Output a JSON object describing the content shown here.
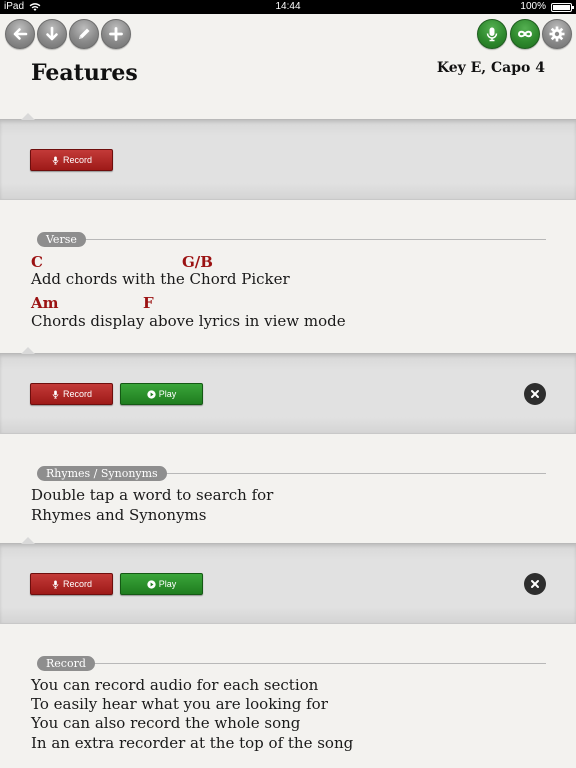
{
  "status": {
    "device": "iPad",
    "time": "14:44",
    "battery": "100%"
  },
  "toolbar": {
    "left_icons": [
      "back-arrow-icon",
      "down-arrow-icon",
      "pencil-icon",
      "plus-icon"
    ],
    "right_icons": [
      "microphone-icon",
      "loop-icon",
      "gear-icon"
    ]
  },
  "header": {
    "title": "Features",
    "key_capo": "Key E, Capo 4"
  },
  "buttons": {
    "record": "Record",
    "play": "Play"
  },
  "sections": [
    {
      "tag": "Verse",
      "lines": [
        {
          "chords": [
            {
              "text": "C"
            },
            {
              "text": "G/B"
            }
          ],
          "lyric": "Add chords with the Chord Picker"
        },
        {
          "chords": [
            {
              "text": "Am"
            },
            {
              "text": "F"
            }
          ],
          "lyric": "Chords display above lyrics in view mode"
        }
      ]
    },
    {
      "tag": "Rhymes / Synonyms",
      "lines": [
        {
          "lyric": "Double tap a word to search for"
        },
        {
          "lyric": "Rhymes and Synonyms"
        }
      ]
    },
    {
      "tag": "Record",
      "lines": [
        {
          "lyric": "You can record audio for each section"
        },
        {
          "lyric": "To easily hear what you are looking for"
        },
        {
          "lyric": "You can also record the whole song"
        },
        {
          "lyric": "In an extra recorder at the top of the song"
        }
      ]
    }
  ],
  "colors": {
    "chord": "#9b1212",
    "record_button": "#b02a28",
    "play_button": "#2e932e",
    "toolbar_green": "#2f8a2e"
  }
}
